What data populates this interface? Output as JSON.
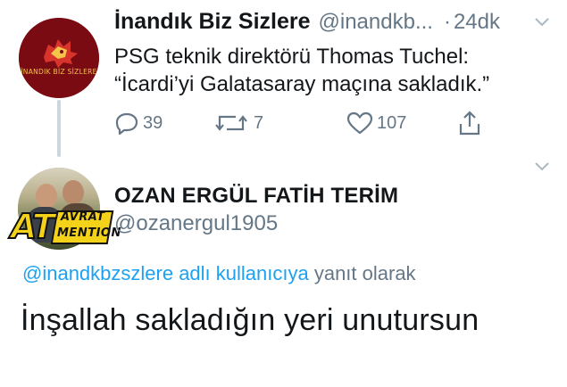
{
  "parent_tweet": {
    "display_name": "İnandık Biz Sizlere",
    "handle": "@inandkb...",
    "separator": "·",
    "time": "24dk",
    "avatar_text": "İNANDIK BİZ SİZLERE",
    "text_lines": [
      "PSG teknik direktörü Thomas Tuchel:",
      "“İcardi’yi Galatasaray maçına sakladık.”"
    ],
    "actions": {
      "reply_count": "39",
      "retweet_count": "7",
      "like_count": "107"
    }
  },
  "reply_tweet": {
    "display_name": "OZAN ERGÜL FATİH TERİM",
    "handle": "@ozanergul1905",
    "sticker": {
      "big": "AT",
      "word1": "AVRAT",
      "word2": "MENTION"
    },
    "replying_to_link": "@inandkbzszlere adlı kullanıcıya",
    "replying_to_suffix": " yanıt olarak",
    "text": "İnşallah sakladığın yeri unutursun"
  },
  "colors": {
    "text": "#14171a",
    "secondary": "#657786",
    "link": "#1da1f2",
    "thread_line": "#ccd6dd",
    "avatar_bg": "#7a0b12"
  },
  "icons": [
    "chevron-down-icon",
    "reply-icon",
    "retweet-icon",
    "like-icon",
    "share-icon",
    "lion-logo-icon"
  ]
}
